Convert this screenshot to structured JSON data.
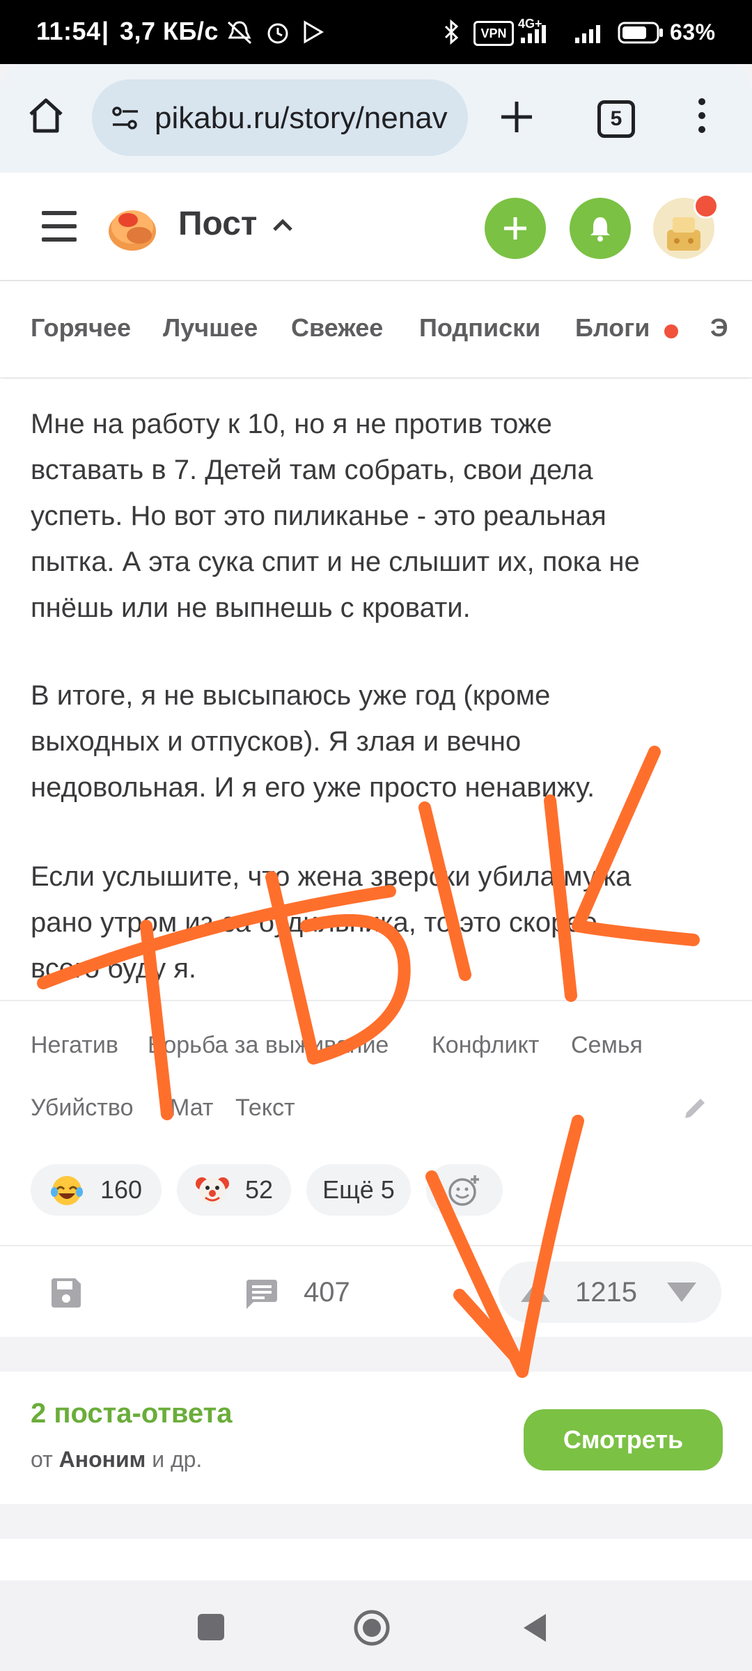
{
  "status_bar": {
    "time": "11:54",
    "speed": "3,7 КБ/с",
    "vpn": "VPN",
    "network": "4G+",
    "battery": "63%"
  },
  "browser": {
    "url": "pikabu.ru/story/nenav",
    "tab_count": "5",
    "icons": [
      "home-icon",
      "site-settings-icon",
      "new-tab-plus-icon",
      "tabs-counter-icon",
      "more-vert-icon"
    ]
  },
  "header": {
    "title": "Пост",
    "icons": [
      "hamburger-menu-icon",
      "pikabu-logo",
      "chevron-up-icon",
      "add-post-icon",
      "bell-icon",
      "avatar"
    ]
  },
  "nav_tabs": [
    "Горячее",
    "Лучшее",
    "Свежее",
    "Подписки",
    "Блоги",
    "Э"
  ],
  "post": {
    "paragraphs": [
      [
        "Мне на работу к 10, но я не против тоже",
        "вставать в 7. Детей там собрать, свои дела",
        "успеть. Но вот это пиликанье - это реальная",
        "пытка. А эта сука спит и не слышит их, пока не",
        "пнёшь или не выпнешь с кровати."
      ],
      [
        "В итоге, я не высыпаюсь уже год (кроме",
        "выходных и отпусков). Я злая и вечно",
        "недовольная. И я его уже просто ненавижу."
      ],
      [
        "Если услышите, что жена зверски убила мужа",
        "рано утром из-за будильника, то это скорее",
        "всего буду я."
      ]
    ],
    "tags_row1": [
      "Негатив",
      "Борьба за выживание",
      "Конфликт",
      "Семья"
    ],
    "tags_row2": [
      "Убийство",
      "Мат",
      "Текст"
    ],
    "reactions": [
      {
        "icon": "laughing-tears-emoji",
        "count": "160"
      },
      {
        "icon": "clown-emoji",
        "count": "52"
      }
    ],
    "more_reactions": "Ещё 5",
    "comments": "407",
    "rating": "1215",
    "accent_green": "#7bc144",
    "annotation_color": "#ff6f2c"
  },
  "replies": {
    "title": "2 поста-ответа",
    "from_prefix": "от ",
    "author": "Аноним",
    "from_suffix": " и др.",
    "button": "Смотреть"
  }
}
